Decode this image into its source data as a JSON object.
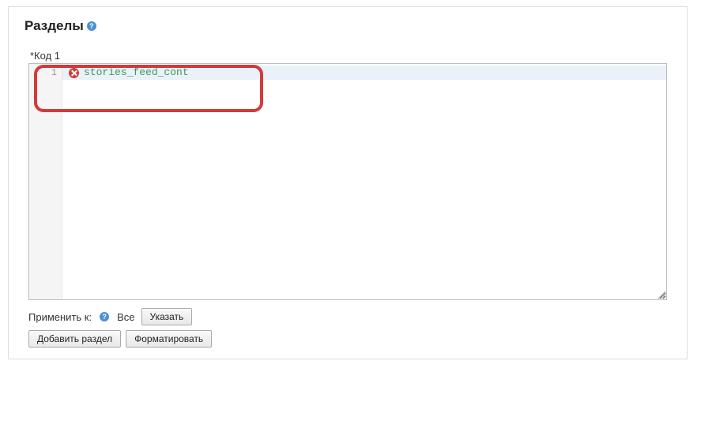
{
  "heading": "Разделы",
  "section": {
    "label": "*Код 1",
    "line_number": "1",
    "code": "stories_feed_cont"
  },
  "apply": {
    "label": "Применить к:",
    "all": "Все",
    "specify_btn": "Указать"
  },
  "buttons": {
    "add_section": "Добавить раздел",
    "format": "Форматировать"
  }
}
